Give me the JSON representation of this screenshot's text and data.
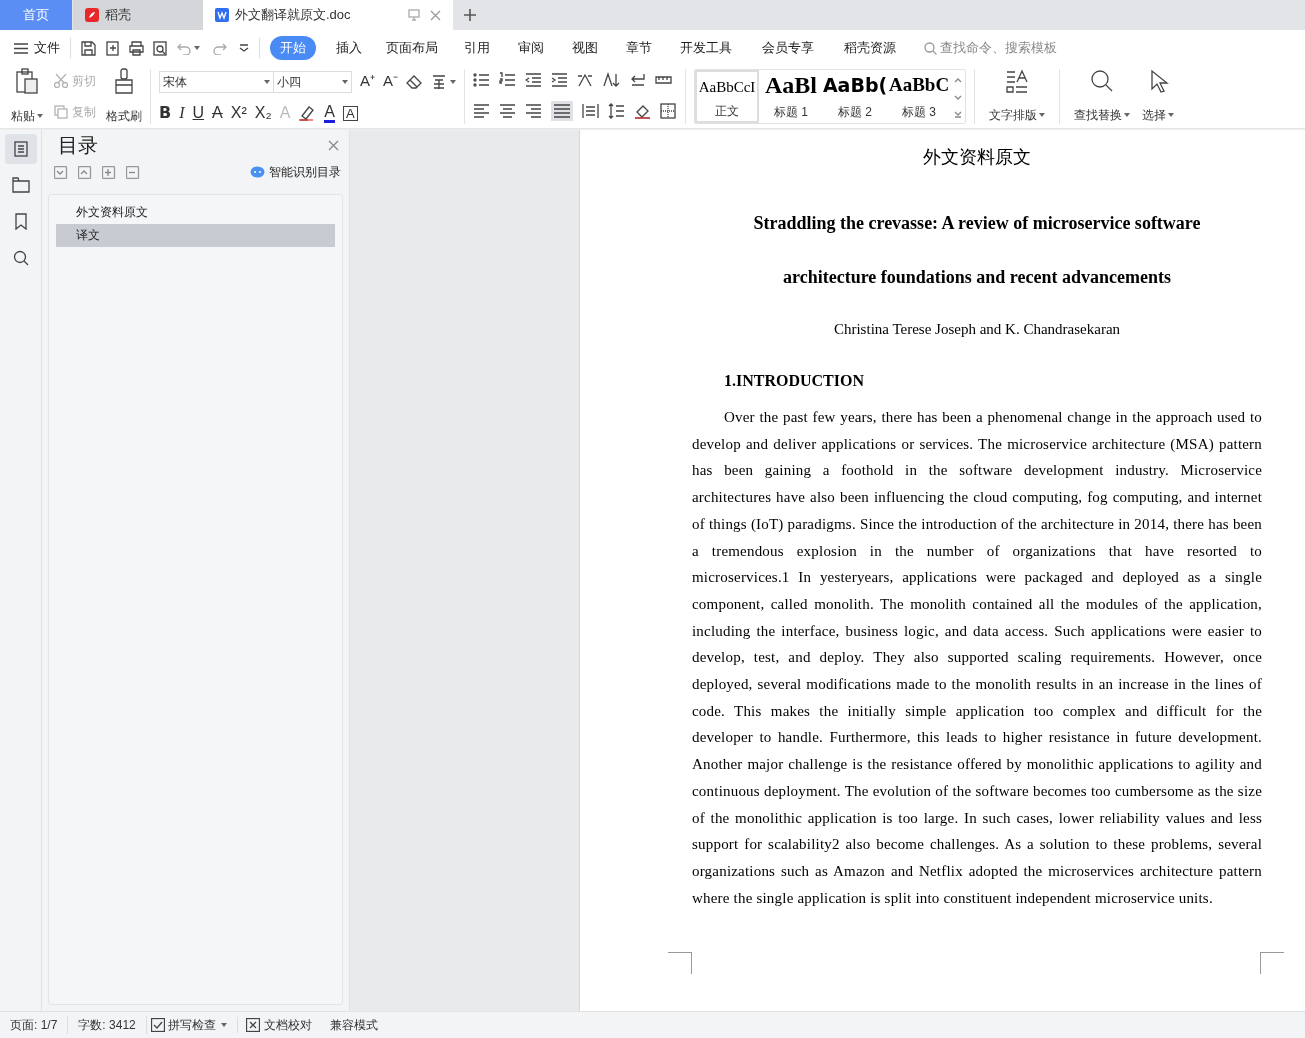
{
  "tabs": [
    {
      "label": "首页",
      "kind": "home",
      "selected": false
    },
    {
      "label": "稻壳",
      "kind": "app",
      "selected": false
    },
    {
      "label": "外文翻译就原文.doc",
      "kind": "doc",
      "selected": true
    }
  ],
  "menu": {
    "file": "文件",
    "items": [
      {
        "label": "开始",
        "selected": true
      },
      {
        "label": "插入",
        "selected": false
      },
      {
        "label": "页面布局",
        "selected": false
      },
      {
        "label": "引用",
        "selected": false
      },
      {
        "label": "审阅",
        "selected": false
      },
      {
        "label": "视图",
        "selected": false
      },
      {
        "label": "章节",
        "selected": false
      },
      {
        "label": "开发工具",
        "selected": false
      },
      {
        "label": "会员专享",
        "selected": false
      },
      {
        "label": "稻壳资源",
        "selected": false
      }
    ],
    "search": {
      "placeholder": "查找命令、搜索模板"
    }
  },
  "ribbon": {
    "paste": "粘贴",
    "cut": {
      "label": "剪切",
      "disabled": true
    },
    "copy": {
      "label": "复制",
      "disabled": true
    },
    "format_painter": "格式刷",
    "font": "宋体",
    "size": "小四",
    "size_buttons": [
      "A⁺",
      "A⁻"
    ],
    "format_buttons": [
      {
        "glyph": "B",
        "kind": "bold"
      },
      {
        "glyph": "I",
        "kind": "italic"
      },
      {
        "glyph": "U",
        "kind": "underline"
      },
      {
        "glyph": "A",
        "kind": "strike"
      },
      {
        "glyph": "X²",
        "kind": "plain"
      },
      {
        "glyph": "X₂",
        "kind": "plain"
      },
      {
        "glyph": "A",
        "kind": "effect"
      }
    ],
    "color_buttons": [
      {
        "glyph": "A",
        "kind": "color"
      },
      {
        "glyph": "A",
        "kind": "border"
      }
    ],
    "styles": [
      {
        "preview": "AaBbCcI",
        "label": "正文",
        "kind": "normal",
        "selected": true
      },
      {
        "preview": "AaBl",
        "label": "标题 1",
        "kind": "h1",
        "selected": false
      },
      {
        "preview": "AaBb(",
        "label": "标题 2",
        "kind": "h2",
        "selected": false
      },
      {
        "preview": "AaBbC",
        "label": "标题 3",
        "kind": "h3",
        "selected": false
      }
    ],
    "text_layout": "文字排版",
    "find_replace": "查找替换",
    "select": "选择"
  },
  "nav_panel": {
    "title": "目录",
    "smart_toc": "智能识别目录",
    "items": [
      {
        "label": "外文资料原文",
        "selected": false
      },
      {
        "label": "译文",
        "selected": true
      }
    ]
  },
  "document": {
    "header": "外文资料原文",
    "title_lines": [
      "Straddling the crevasse: A review of microservice software",
      "architecture foundations and recent advancements"
    ],
    "authors": "Christina Terese Joseph and K. Chandrasekaran",
    "heading": "1.INTRODUCTION",
    "paragraph": "Over the past few years, there has been a phenomenal change in the approach used to develop and deliver applications or services. The microservice architecture (MSA) pattern has been gaining a foothold in the software development industry. Microservice architectures have also been influencing the cloud computing, fog computing, and internet of things (IoT) paradigms. Since the introduction of the architecture in 2014, there has been a tremendous explosion in the number of organizations that have resorted to microservices.1 In yesteryears, applications were packaged and deployed as a single component, called monolith. The monolith contained all the modules of the application, including the interface, business logic, and data access. Such applications were easier to develop, test, and deploy. They also supported scaling requirements. However, once deployed, several modifications made to the monolith results in an increase in the lines of code. This makes the initially simple application too complex and difficult for the developer to handle. Furthermore, this leads to higher resistance in future development. Another major challenge is the resistance offered by monolithic applications to agility and continuous deployment. The evolution of the software becomes too cumbersome as the size of the monolithic application is too large. In such cases, lower reliability values and less support for scalability2 also become challenges. As a solution to these problems, several organizations such as Amazon and Netflix adopted the microservices architecture pattern where the single application is split into constituent independent microservice units."
  },
  "status_bar": {
    "page": "页面: 1/7",
    "words": "字数: 3412",
    "spell_check": "拼写检查",
    "doc_check": "文档校对",
    "mode": "兼容模式"
  }
}
